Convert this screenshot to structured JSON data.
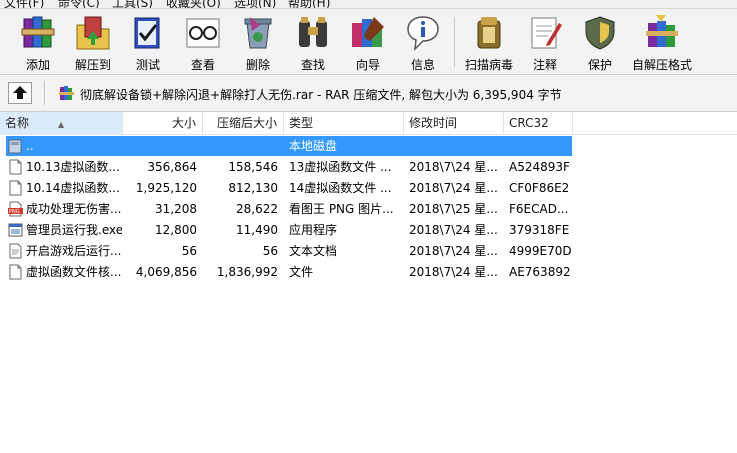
{
  "menu": {
    "items": [
      "文件(F)",
      "命令(C)",
      "工具(S)",
      "收藏夹(O)",
      "选项(N)",
      "帮助(H)"
    ]
  },
  "toolbar": {
    "buttons": [
      {
        "label": "添加",
        "icon": "add-books-icon"
      },
      {
        "label": "解压到",
        "icon": "extract-folder-icon"
      },
      {
        "label": "测试",
        "icon": "test-check-icon"
      },
      {
        "label": "查看",
        "icon": "view-glasses-icon"
      },
      {
        "label": "删除",
        "icon": "delete-recycle-icon"
      },
      {
        "label": "查找",
        "icon": "find-binoculars-icon"
      },
      {
        "label": "向导",
        "icon": "wizard-icon"
      },
      {
        "label": "信息",
        "icon": "info-icon"
      },
      {
        "label": "扫描病毒",
        "icon": "virus-scan-icon"
      },
      {
        "label": "注释",
        "icon": "comment-note-icon"
      },
      {
        "label": "保护",
        "icon": "protect-shield-icon"
      },
      {
        "label": "自解压格式",
        "icon": "sfx-icon"
      }
    ]
  },
  "pathbar": {
    "text": "彻底解设备锁+解除闪退+解除打人无伤.rar - RAR 压缩文件, 解包大小为 6,395,904 字节"
  },
  "columns": {
    "name": "名称",
    "size": "大小",
    "packed": "压缩后大小",
    "type": "类型",
    "modified": "修改时间",
    "crc": "CRC32"
  },
  "files": [
    {
      "name": "..",
      "size": "",
      "packed": "",
      "type": "本地磁盘",
      "modified": "",
      "crc": "",
      "icon": "parent-folder-icon",
      "selected": true
    },
    {
      "name": "10.13虚拟函数...",
      "size": "356,864",
      "packed": "158,546",
      "type": "13虚拟函数文件 ...",
      "modified": "2018\\7\\24 星...",
      "crc": "A524893F",
      "icon": "file-icon",
      "selected": false
    },
    {
      "name": "10.14虚拟函数...",
      "size": "1,925,120",
      "packed": "812,130",
      "type": "14虚拟函数文件 ...",
      "modified": "2018\\7\\24 星...",
      "crc": "CF0F86E2",
      "icon": "file-icon",
      "selected": false
    },
    {
      "name": "成功处理无伤害...",
      "size": "31,208",
      "packed": "28,622",
      "type": "看图王 PNG 图片...",
      "modified": "2018\\7\\25 星...",
      "crc": "F6ECAD...",
      "icon": "png-file-icon",
      "selected": false
    },
    {
      "name": "管理员运行我.exe",
      "size": "12,800",
      "packed": "11,490",
      "type": "应用程序",
      "modified": "2018\\7\\24 星...",
      "crc": "379318FE",
      "icon": "exe-file-icon",
      "selected": false
    },
    {
      "name": "开启游戏后运行...",
      "size": "56",
      "packed": "56",
      "type": "文本文档",
      "modified": "2018\\7\\24 星...",
      "crc": "4999E70D",
      "icon": "text-file-icon",
      "selected": false
    },
    {
      "name": "虚拟函数文件核...",
      "size": "4,069,856",
      "packed": "1,836,992",
      "type": "文件",
      "modified": "2018\\7\\24 星...",
      "crc": "AE763892",
      "icon": "file-icon",
      "selected": false
    }
  ],
  "colors": {
    "selection": "#3399ff",
    "sorted_header": "#dcebfc"
  }
}
